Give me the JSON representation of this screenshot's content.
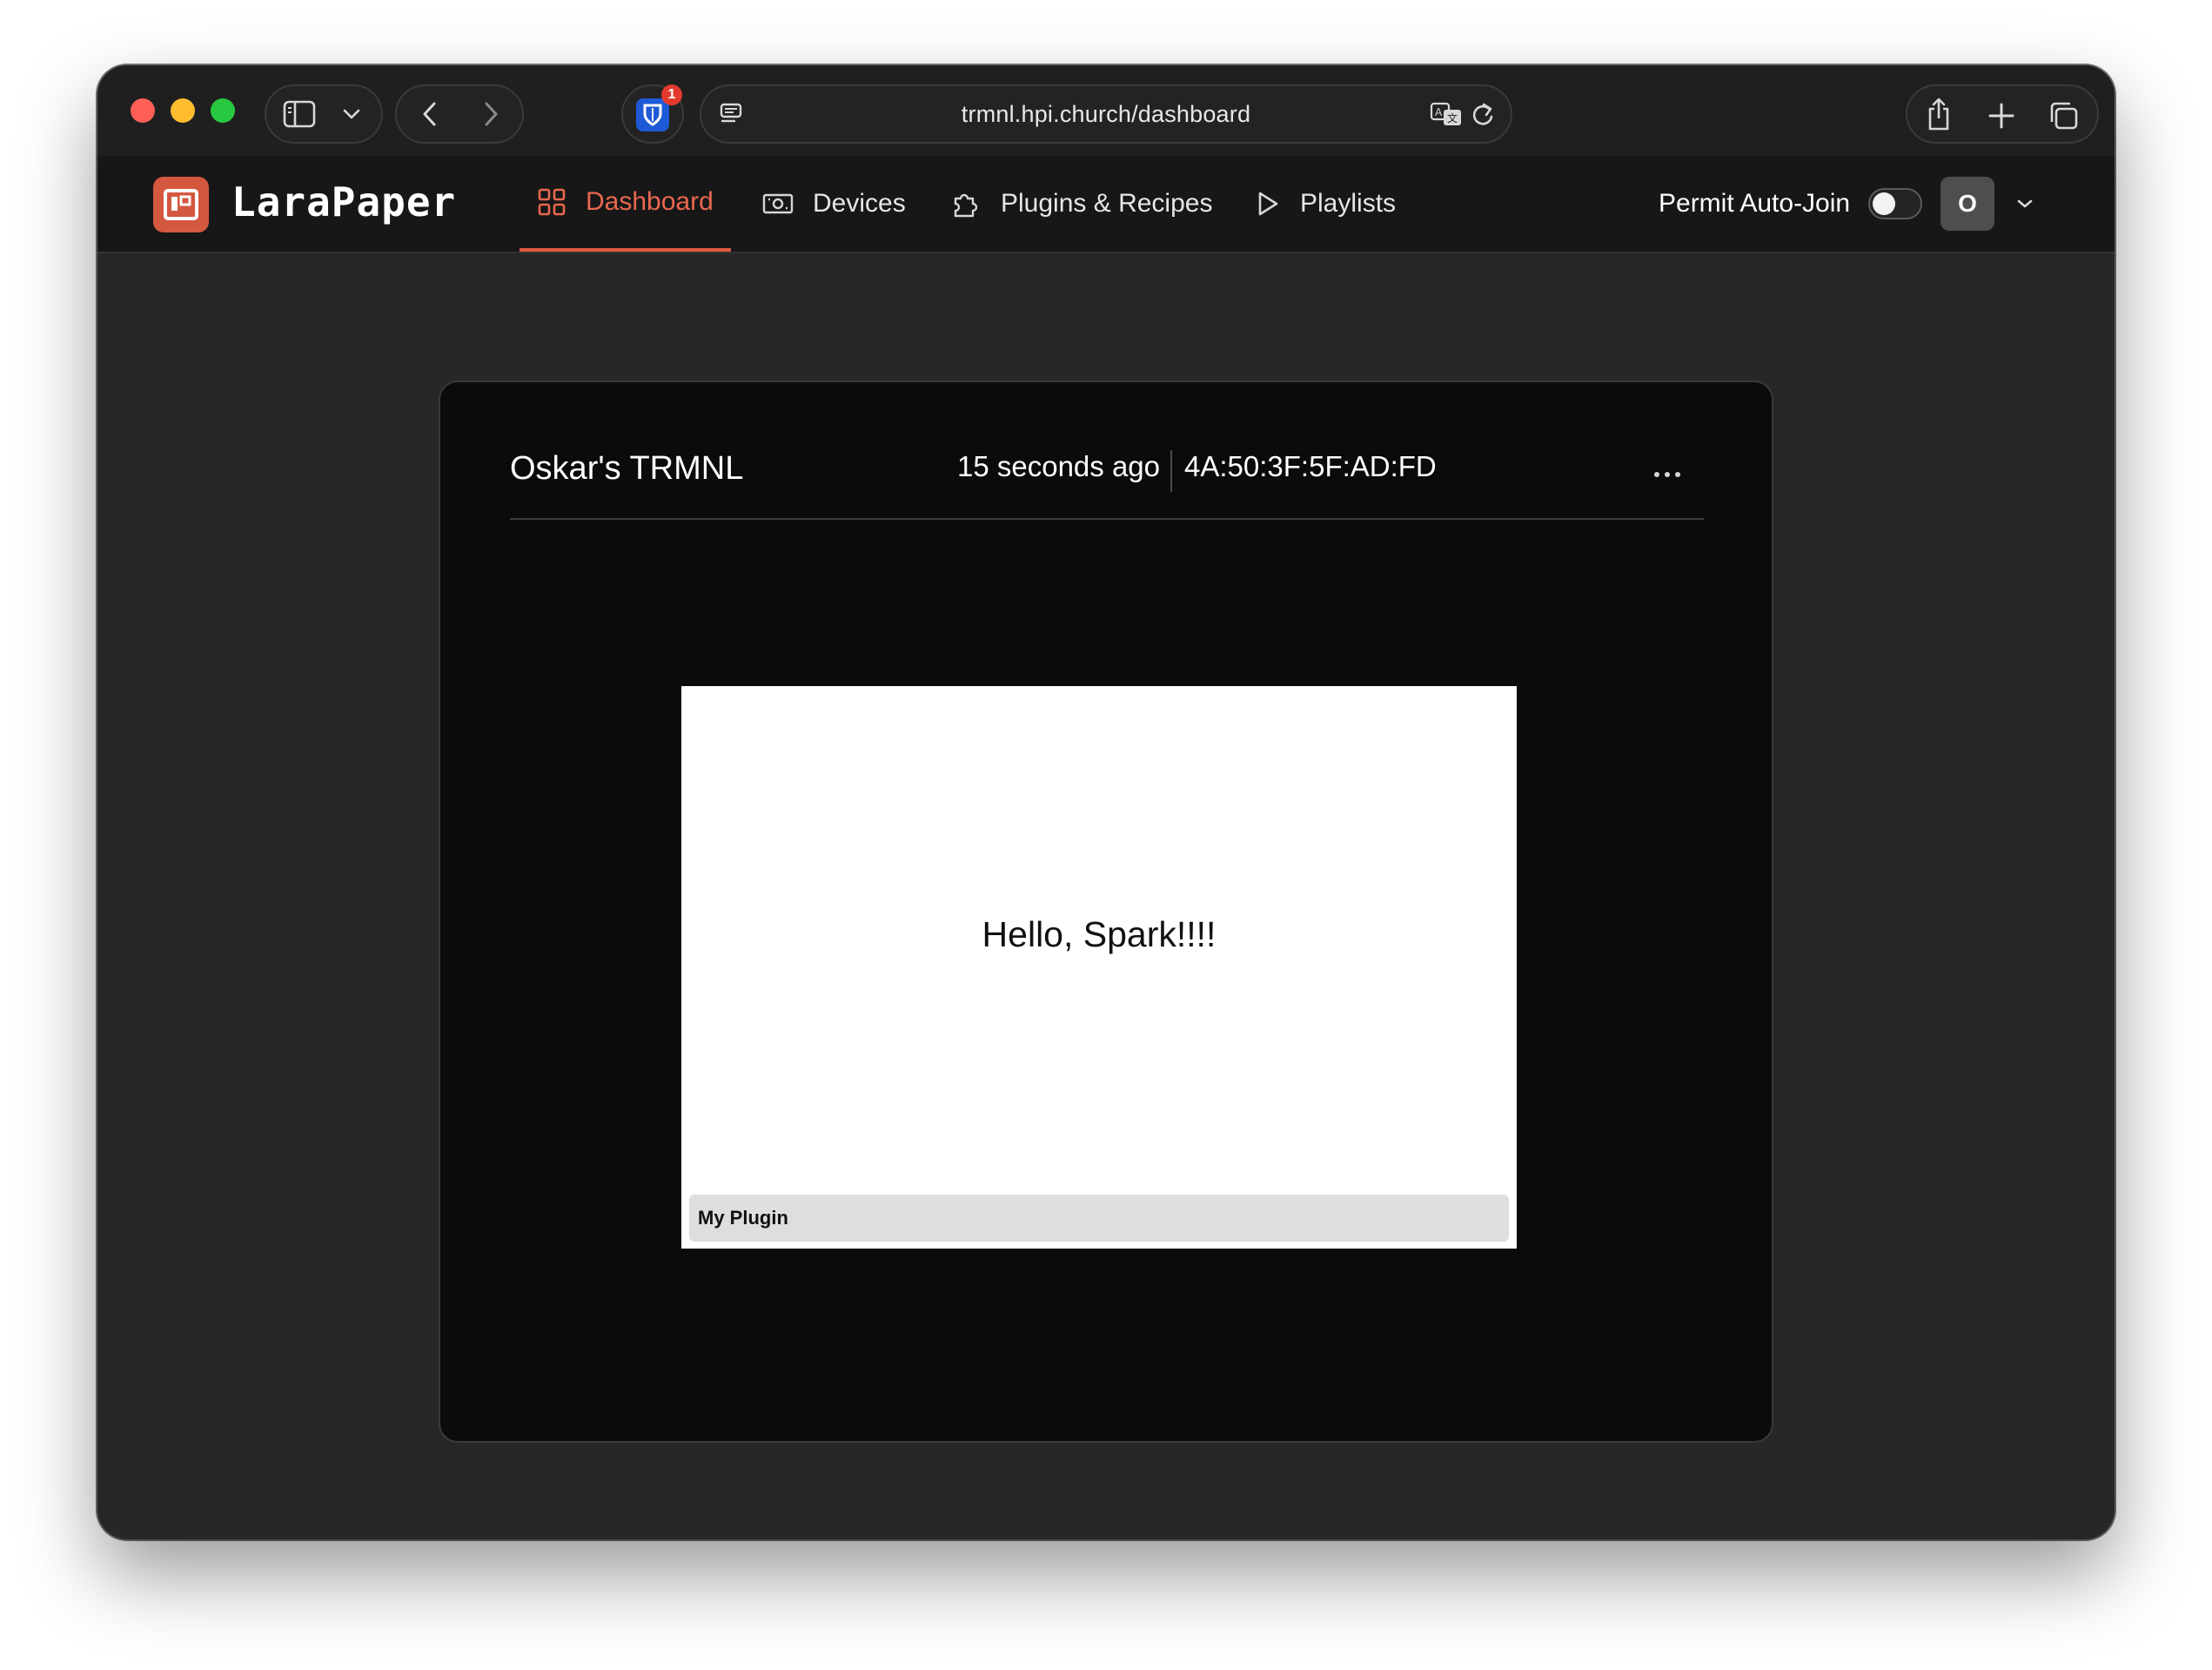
{
  "browser": {
    "url": "trmnl.hpi.church/dashboard",
    "extension_badge_count": "1",
    "icons": [
      "sidebar-icon",
      "chevron-down-icon",
      "back-icon",
      "forward-icon",
      "bitwarden-icon",
      "reader-icon",
      "translate-icon",
      "reload-icon",
      "share-icon",
      "new-tab-icon",
      "tabs-overview-icon"
    ]
  },
  "app": {
    "brand": "LaraPaper",
    "accent_color": "#e0593f",
    "nav": {
      "dashboard": "Dashboard",
      "devices": "Devices",
      "plugins": "Plugins & Recipes",
      "playlists": "Playlists"
    },
    "permit_auto_join_label": "Permit Auto-Join",
    "permit_auto_join_enabled": false,
    "user_initial": "O"
  },
  "device": {
    "name": "Oskar's TRMNL",
    "last_seen": "15 seconds ago",
    "mac": "4A:50:3F:5F:AD:FD",
    "screen": {
      "content": "Hello, Spark!!!!",
      "footer": "My Plugin"
    }
  }
}
